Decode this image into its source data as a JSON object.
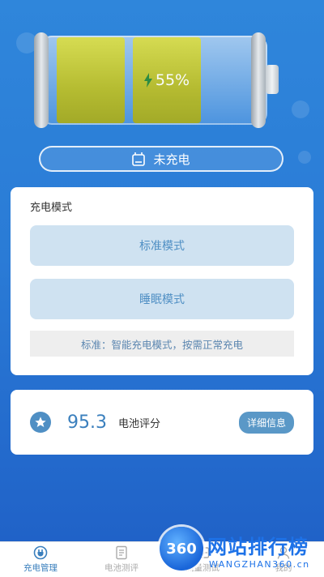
{
  "battery": {
    "level_text": "55%"
  },
  "status": {
    "text": "未充电"
  },
  "charge_mode": {
    "title": "充电模式",
    "buttons": [
      {
        "label": "标准模式"
      },
      {
        "label": "睡眠模式"
      }
    ],
    "description": "标准：智能充电模式，按需正常充电"
  },
  "score": {
    "value": "95.3",
    "label": "电池评分",
    "detail_button": "详细信息"
  },
  "nav": {
    "items": [
      {
        "label": "充电管理",
        "icon": "plug-icon"
      },
      {
        "label": "电池测评",
        "icon": "document-icon"
      },
      {
        "label": "流量测试",
        "icon": "wave-icon"
      },
      {
        "label": "我的",
        "icon": "user-icon"
      }
    ]
  },
  "watermark": {
    "badge": "360",
    "title": "网站排行榜",
    "subtitle": "WANGZHAN360.cn"
  },
  "colors": {
    "accent": "#3a7fbd",
    "battery_fill": "#c8cc34",
    "background": "#2a7bd6"
  }
}
